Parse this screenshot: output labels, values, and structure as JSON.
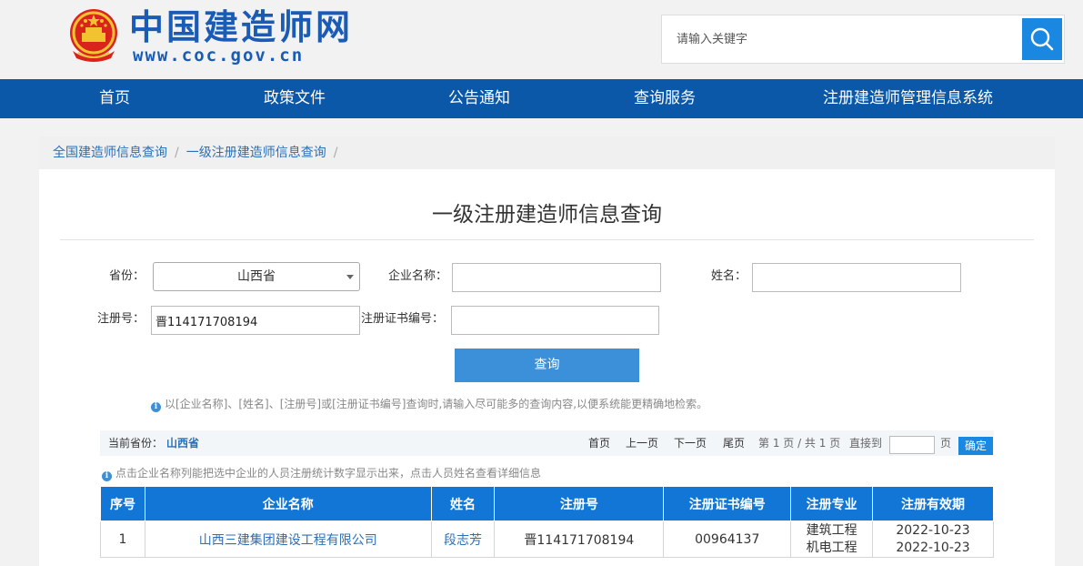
{
  "header": {
    "site_title": "中国建造师网",
    "site_url": "www.coc.gov.cn",
    "search": {
      "placeholder": "请输入关键字",
      "value": ""
    }
  },
  "nav": {
    "items": [
      {
        "label": "首页"
      },
      {
        "label": "政策文件"
      },
      {
        "label": "公告通知"
      },
      {
        "label": "查询服务"
      },
      {
        "label": "注册建造师管理信息系统"
      }
    ]
  },
  "breadcrumb": {
    "items": [
      {
        "label": "全国建造师信息查询"
      },
      {
        "label": "一级注册建造师信息查询"
      }
    ],
    "separator": "/"
  },
  "page": {
    "title": "一级注册建造师信息查询"
  },
  "form": {
    "province_label": "省份：",
    "province_value": "山西省",
    "company_label": "企业名称：",
    "company_value": "",
    "name_label": "姓名：",
    "name_value": "",
    "reg_no_label": "注册号：",
    "reg_no_value": "晋114171708194",
    "cert_no_label": "注册证书编号：",
    "cert_no_value": "",
    "query_button": "查询",
    "tip": "以[企业名称]、[姓名]、[注册号]或[注册证书编号]查询时,请输入尽可能多的查询内容,以便系统能更精确地检索。"
  },
  "pager": {
    "current_province_label": "当前省份：",
    "current_province": "山西省",
    "first": "首页",
    "prev": "上一页",
    "next": "下一页",
    "last": "尾页",
    "page_info": "第 1 页 / 共 1 页",
    "goto_label": "直接到",
    "goto_value": "",
    "page_unit": "页",
    "confirm": "确定"
  },
  "results": {
    "tip": "点击企业名称列能把选中企业的人员注册统计数字显示出来，点击人员姓名查看详细信息",
    "columns": [
      "序号",
      "企业名称",
      "姓名",
      "注册号",
      "注册证书编号",
      "注册专业",
      "注册有效期"
    ],
    "rows": [
      {
        "index": "1",
        "company": "山西三建集团建设工程有限公司",
        "name": "段志芳",
        "reg_no": "晋114171708194",
        "cert_no": "00964137",
        "specialty_1": "建筑工程",
        "specialty_2": "机电工程",
        "validity_1": "2022-10-23",
        "validity_2": "2022-10-23"
      }
    ]
  },
  "colors": {
    "brand_blue": "#0b57a8",
    "header_blue": "#1276d6",
    "button_blue": "#3c8fd9",
    "link_blue": "#2d6fb5",
    "title_blue": "#1a5bb5"
  }
}
